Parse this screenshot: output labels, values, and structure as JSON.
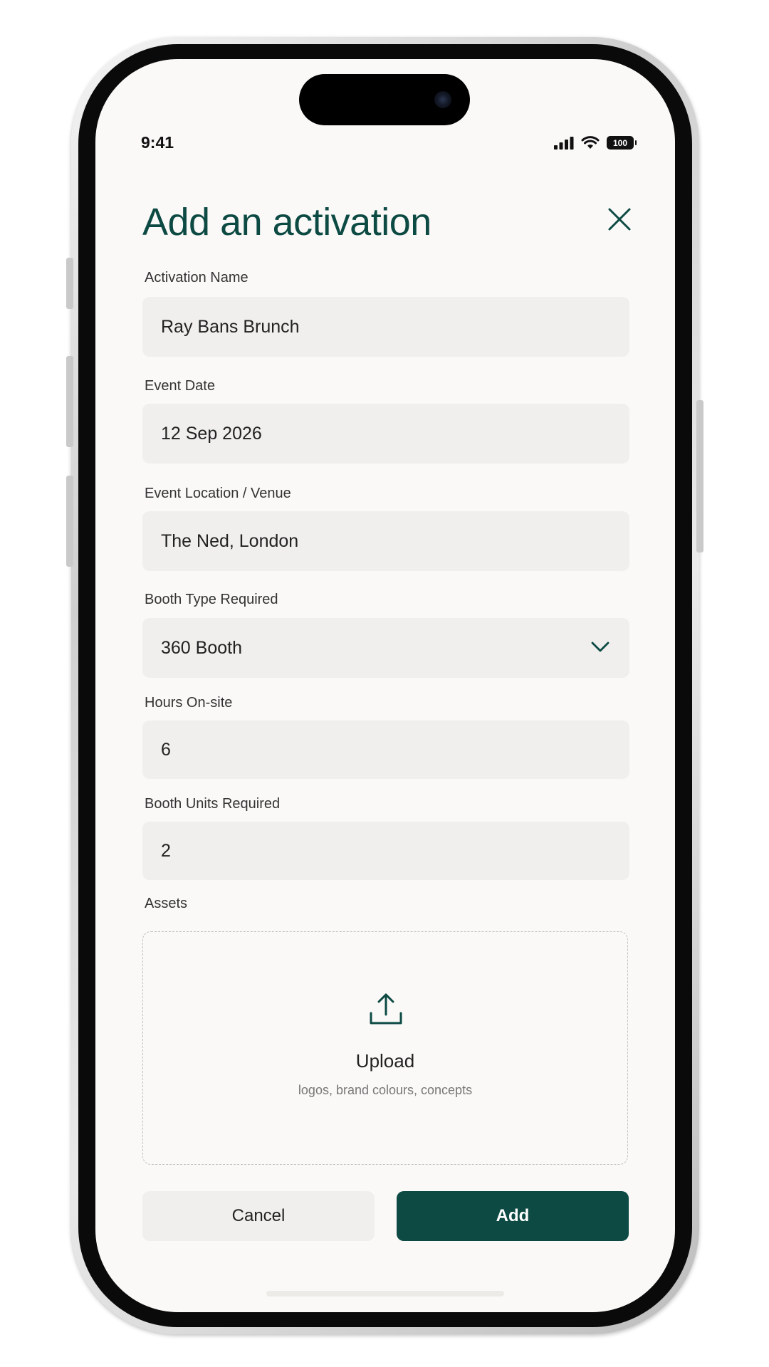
{
  "status_bar": {
    "time": "9:41",
    "battery": "100"
  },
  "header": {
    "title": "Add an activation"
  },
  "form": {
    "activation_name": {
      "label": "Activation Name",
      "value": "Ray Bans Brunch"
    },
    "event_date": {
      "label": "Event Date",
      "value": "12 Sep 2026"
    },
    "event_location": {
      "label": "Event Location / Venue",
      "value": "The Ned, London"
    },
    "booth_type": {
      "label": "Booth Type Required",
      "value": "360 Booth"
    },
    "hours_onsite": {
      "label": "Hours On-site",
      "value": "6"
    },
    "booth_units": {
      "label": "Booth Units Required",
      "value": "2"
    },
    "assets": {
      "label": "Assets",
      "upload_title": "Upload",
      "upload_hint": "logos, brand colours, concepts"
    }
  },
  "actions": {
    "cancel_label": "Cancel",
    "add_label": "Add"
  },
  "colors": {
    "accent": "#0d4a43",
    "field_bg": "#f0efed",
    "screen_bg": "#faf9f7"
  },
  "icons": [
    "close-icon",
    "chevron-down-icon",
    "upload-icon",
    "signal-icon",
    "wifi-icon",
    "battery-icon"
  ]
}
